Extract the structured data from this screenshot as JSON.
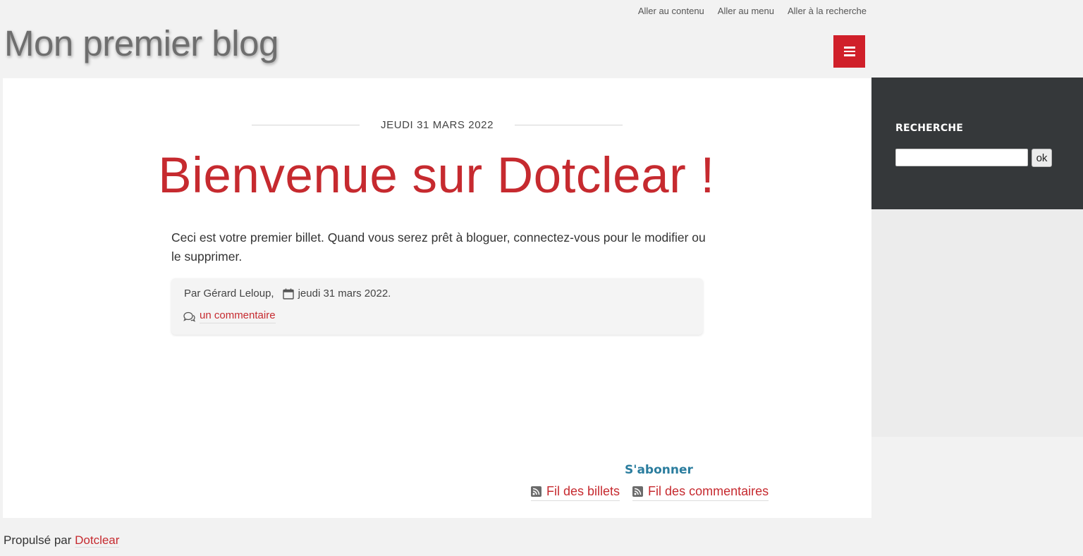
{
  "skip_links": {
    "content": "Aller au contenu",
    "menu": "Aller au menu",
    "search": "Aller à la recherche"
  },
  "site": {
    "title": "Mon premier blog"
  },
  "colors": {
    "accent": "#c62a2f",
    "menu_button": "#d0202a",
    "sidebar_bg": "#35383a",
    "subscribe_title": "#2b7d9e"
  },
  "icons": {
    "menu": "hamburger-icon",
    "calendar": "calendar-icon",
    "comment": "comment-icon",
    "feed": "rss-feed-icon"
  },
  "post": {
    "date": "JEUDI 31 MARS 2022",
    "title": "Bienvenue sur Dotclear !",
    "content": "Ceci est votre premier billet. Quand vous serez prêt à bloguer, connectez-vous pour le modifier ou le supprimer.",
    "author": "Par Gérard Leloup,",
    "meta_date": "jeudi 31 mars 2022.",
    "comments_link": "un commentaire"
  },
  "subscribe": {
    "title": "S'abonner",
    "entries_feed": "Fil des billets",
    "comments_feed": "Fil des commentaires"
  },
  "sidebar": {
    "search_title": "RECHERCHE",
    "search_value": "",
    "search_button": "ok"
  },
  "footer": {
    "powered_by": "Propulsé par",
    "powered_link": "Dotclear"
  }
}
